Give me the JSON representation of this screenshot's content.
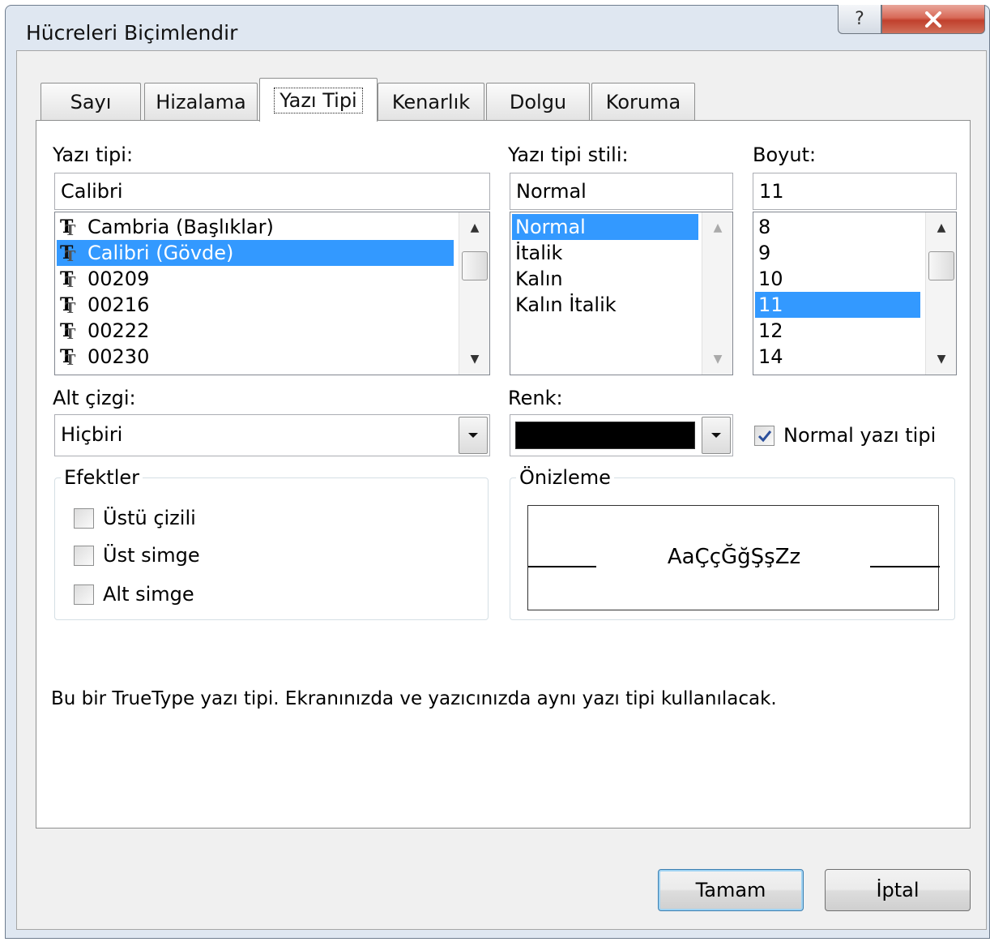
{
  "window": {
    "title": "Hücreleri Biçimlendir",
    "help_glyph": "?",
    "close_glyph": "X"
  },
  "tabs": [
    {
      "label": "Sayı"
    },
    {
      "label": "Hizalama"
    },
    {
      "label": "Yazı Tipi",
      "active": true
    },
    {
      "label": "Kenarlık"
    },
    {
      "label": "Dolgu"
    },
    {
      "label": "Koruma"
    }
  ],
  "font": {
    "label": "Yazı tipi:",
    "value": "Calibri",
    "items": [
      "Cambria (Başlıklar)",
      "Calibri (Gövde)",
      "00209",
      "00216",
      "00222",
      "00230"
    ],
    "selected_index": 1
  },
  "style": {
    "label": "Yazı tipi stili:",
    "value": "Normal",
    "items": [
      "Normal",
      "İtalik",
      "Kalın",
      "Kalın İtalik"
    ],
    "selected_index": 0
  },
  "size": {
    "label": "Boyut:",
    "value": "11",
    "items": [
      "8",
      "9",
      "10",
      "11",
      "12",
      "14"
    ],
    "selected_index": 3
  },
  "underline": {
    "label": "Alt çizgi:",
    "value": "Hiçbiri"
  },
  "color": {
    "label": "Renk:",
    "swatch": "#000000"
  },
  "normal_font": {
    "label": "Normal yazı tipi",
    "checked": true
  },
  "effects": {
    "title": "Efektler",
    "items": [
      {
        "label": "Üstü çizili",
        "checked": false
      },
      {
        "label": "Üst simge",
        "checked": false
      },
      {
        "label": "Alt simge",
        "checked": false
      }
    ]
  },
  "preview": {
    "title": "Önizleme",
    "sample": "AaÇçĞğŞşZz"
  },
  "info_text": "Bu bir TrueType yazı tipi. Ekranınızda ve yazıcınızda aynı yazı tipi kullanılacak.",
  "buttons": {
    "ok": "Tamam",
    "cancel": "İptal"
  },
  "colors": {
    "selection": "#3399ff",
    "close_button": "#c94a36",
    "client_bg": "#f0f0f0"
  }
}
